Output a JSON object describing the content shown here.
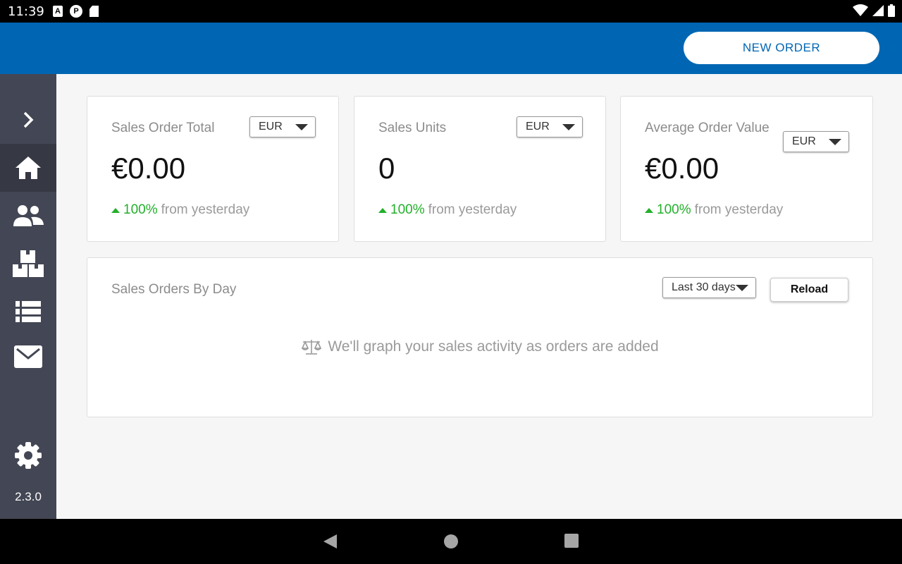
{
  "status_bar": {
    "time": "11:39",
    "icons": [
      "a-notification-icon",
      "p-notification-icon",
      "sd-card-icon",
      "wifi-icon",
      "signal-icon",
      "battery-icon"
    ]
  },
  "app_bar": {
    "new_order_label": "NEW ORDER",
    "color": "#0066b3"
  },
  "sidebar": {
    "items": [
      {
        "icon": "chevron-right-icon"
      },
      {
        "icon": "home-icon",
        "active": true
      },
      {
        "icon": "customers-icon"
      },
      {
        "icon": "products-icon"
      },
      {
        "icon": "orders-list-icon"
      },
      {
        "icon": "mail-icon"
      },
      {
        "icon": "gear-icon"
      }
    ],
    "version": "2.3.0"
  },
  "cards": [
    {
      "title": "Sales Order Total",
      "currency": "EUR",
      "value": "€0.00",
      "delta_pct": "100%",
      "delta_text": "from yesterday"
    },
    {
      "title": "Sales Units",
      "currency": "EUR",
      "value": "0",
      "delta_pct": "100%",
      "delta_text": "from yesterday"
    },
    {
      "title": "Average Order Value",
      "currency": "EUR",
      "value": "€0.00",
      "delta_pct": "100%",
      "delta_text": "from yesterday"
    }
  ],
  "sales_by_day": {
    "title": "Sales Orders By Day",
    "range": "Last 30 days",
    "reload_label": "Reload",
    "empty_message": "We'll graph your sales activity as orders are added"
  },
  "colors": {
    "accent": "#0066b3",
    "positive": "#22b02a",
    "sidebar": "#434654"
  }
}
